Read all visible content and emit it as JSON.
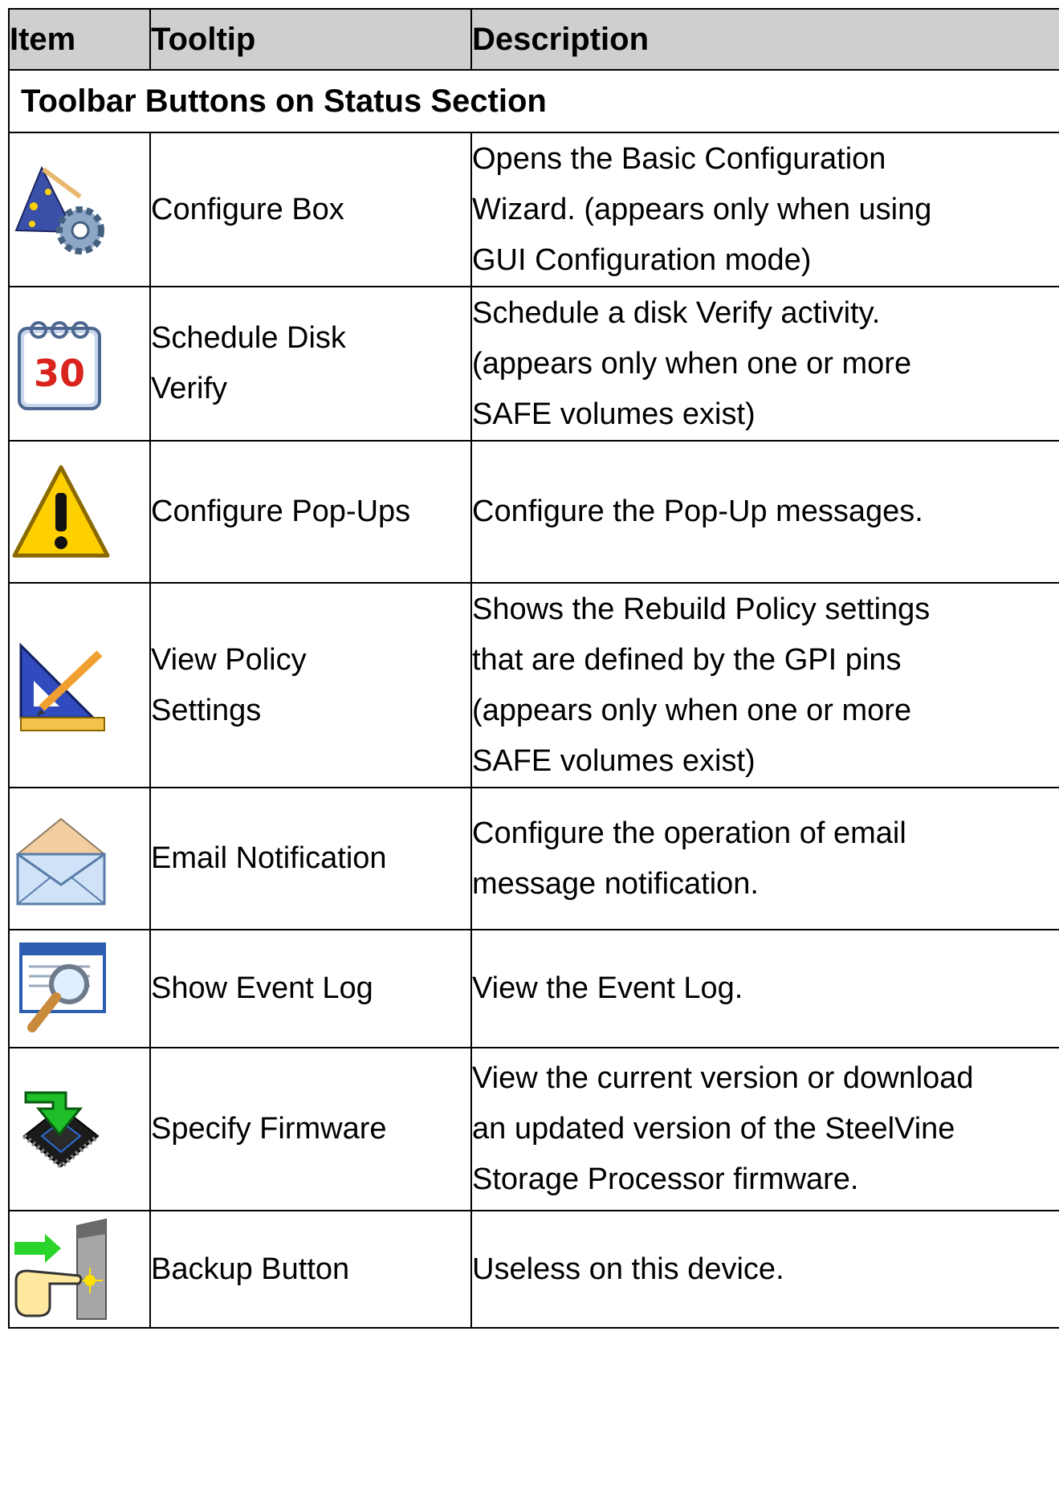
{
  "table": {
    "headers": [
      "Item",
      "Tooltip",
      "Description"
    ],
    "section_title": "Toolbar Buttons on Status Section",
    "rows": [
      {
        "icon": "wizard-gear-icon",
        "tooltip_lines": [
          "Configure Box"
        ],
        "description_lines": [
          "Opens the Basic Configuration",
          "Wizard. (appears only when using",
          "GUI Configuration mode)"
        ]
      },
      {
        "icon": "calendar-icon",
        "tooltip_lines": [
          "Schedule Disk",
          "Verify"
        ],
        "description_lines": [
          "Schedule a disk Verify activity.",
          "(appears only when one or more",
          "SAFE volumes exist)"
        ],
        "calendar_number": "30"
      },
      {
        "icon": "warning-icon",
        "tooltip_lines": [
          "Configure Pop-Ups"
        ],
        "description_lines": [
          "Configure the Pop-Up messages."
        ]
      },
      {
        "icon": "set-square-pencil-icon",
        "tooltip_lines": [
          "View Policy",
          "Settings"
        ],
        "description_lines": [
          "Shows the Rebuild Policy settings",
          "that are defined by the GPI pins",
          "(appears only when one or more",
          "SAFE volumes exist)"
        ]
      },
      {
        "icon": "open-envelope-icon",
        "tooltip_lines": [
          "Email Notification"
        ],
        "description_lines": [
          "Configure the operation of email",
          "message notification."
        ]
      },
      {
        "icon": "magnifier-window-icon",
        "tooltip_lines": [
          "Show Event Log"
        ],
        "description_lines": [
          "View the Event Log."
        ]
      },
      {
        "icon": "firmware-chip-arrow-icon",
        "tooltip_lines": [
          "Specify Firmware"
        ],
        "description_lines": [
          "View the current version or download",
          "an updated version of the SteelVine",
          "Storage Processor firmware."
        ]
      },
      {
        "icon": "hand-press-button-icon",
        "tooltip_lines": [
          "Backup Button"
        ],
        "description_lines": [
          "Useless on this device."
        ]
      }
    ]
  }
}
